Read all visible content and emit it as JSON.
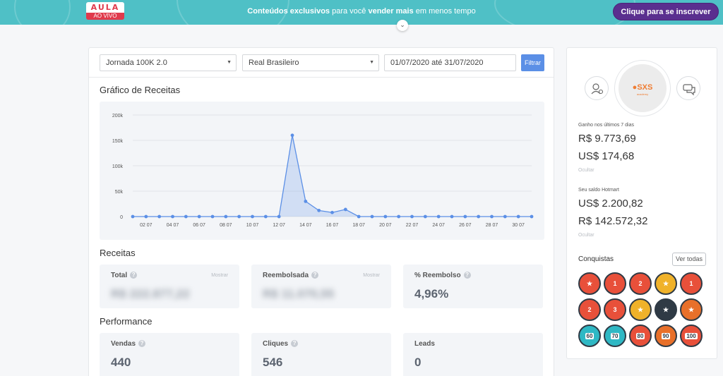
{
  "banner": {
    "logo_top": "AULA",
    "logo_bottom": "AO VIVO",
    "promo_bold1": "Conteúdos exclusivos",
    "promo_mid": " para você ",
    "promo_bold2": "vender mais",
    "promo_end": " em menos tempo",
    "subscribe_label": "Clique para se inscrever",
    "expand_icon": "chevron-down-icon",
    "bg_color": "#4fc0c6",
    "button_color": "#5a2f8f"
  },
  "filters": {
    "product": "Jornada 100K 2.0",
    "currency": "Real Brasileiro",
    "date_range": "01/07/2020 até 31/07/2020",
    "filter_label": "Filtrar"
  },
  "chart_section_title": "Gráfico de Receitas",
  "chart_data": {
    "type": "area",
    "title": "",
    "xlabel": "",
    "ylabel": "",
    "ylim": [
      0,
      200000
    ],
    "y_ticks": [
      "0",
      "50k",
      "100k",
      "150k",
      "200k"
    ],
    "x_tick_labels": [
      "02 07",
      "04 07",
      "06 07",
      "08 07",
      "10 07",
      "12 07",
      "14 07",
      "16 07",
      "18 07",
      "20 07",
      "22 07",
      "24 07",
      "26 07",
      "28 07",
      "30 07"
    ],
    "x": [
      1,
      2,
      3,
      4,
      5,
      6,
      7,
      8,
      9,
      10,
      11,
      12,
      13,
      14,
      15,
      16,
      17,
      18,
      19,
      20,
      21,
      22,
      23,
      24,
      25,
      26,
      27,
      28,
      29,
      30,
      31
    ],
    "values": [
      0,
      0,
      0,
      0,
      0,
      0,
      0,
      0,
      0,
      0,
      0,
      0,
      160000,
      30000,
      12000,
      8000,
      14000,
      0,
      0,
      0,
      0,
      0,
      0,
      0,
      0,
      0,
      0,
      0,
      0,
      0,
      0
    ],
    "color": "#5b8fe6",
    "grid": true
  },
  "revenue": {
    "title": "Receitas",
    "total_label": "Total",
    "total_show": "Mostrar",
    "total_value": "R$ 222.877,22",
    "refund_label": "Reembolsada",
    "refund_show": "Mostrar",
    "refund_value": "R$ 11.070,55",
    "refund_pct_label": "% Reembolso",
    "refund_pct_value": "4,96%"
  },
  "performance": {
    "title": "Performance",
    "sales_label": "Vendas",
    "sales_value": "440",
    "clicks_label": "Cliques",
    "clicks_value": "546",
    "leads_label": "Leads",
    "leads_value": "0"
  },
  "profile": {
    "brand": "●SXS",
    "brand_sub": "academy",
    "earned_label": "Ganho nos últimos 7 dias",
    "earned_brl": "R$ 9.773,69",
    "earned_usd": "US$ 174,68",
    "hide1": "Ocultar",
    "balance_label": "Seu saldo Hotmart",
    "balance_usd": "US$ 2.200,82",
    "balance_brl": "R$ 142.572,32",
    "hide2": "Ocultar",
    "achievements_title": "Conquistas",
    "see_all": "Ver todas",
    "left_icon": "users-gear-icon",
    "right_icon": "chat-icon"
  },
  "badges": [
    {
      "text": "",
      "color": "#e8503a",
      "icon": "trophy-badge-icon"
    },
    {
      "text": "1",
      "color": "#e8503a",
      "icon": "medal-badge-icon"
    },
    {
      "text": "2",
      "color": "#e8503a",
      "icon": "medal-badge-icon"
    },
    {
      "text": "",
      "color": "#f0b22a",
      "icon": "cup-badge-icon"
    },
    {
      "text": "1",
      "color": "#e8503a",
      "icon": "medal-badge-icon"
    },
    {
      "text": "2",
      "color": "#e8503a",
      "icon": "medal-badge-icon"
    },
    {
      "text": "3",
      "color": "#e8503a",
      "icon": "medal-badge-icon"
    },
    {
      "text": "",
      "color": "#f0b22a",
      "icon": "star-badge-icon"
    },
    {
      "text": "",
      "color": "#2f3a45",
      "icon": "ninja-badge-icon"
    },
    {
      "text": "",
      "color": "#e8702a",
      "icon": "mountain-badge-icon"
    },
    {
      "text": "60",
      "color": "#2fb8c4",
      "icon": "level-badge-icon"
    },
    {
      "text": "70",
      "color": "#2fb8c4",
      "icon": "level-badge-icon"
    },
    {
      "text": "80",
      "color": "#e8503a",
      "icon": "level-badge-icon"
    },
    {
      "text": "90",
      "color": "#e8702a",
      "icon": "level-badge-icon"
    },
    {
      "text": "100",
      "color": "#e8503a",
      "icon": "level-badge-icon"
    }
  ]
}
